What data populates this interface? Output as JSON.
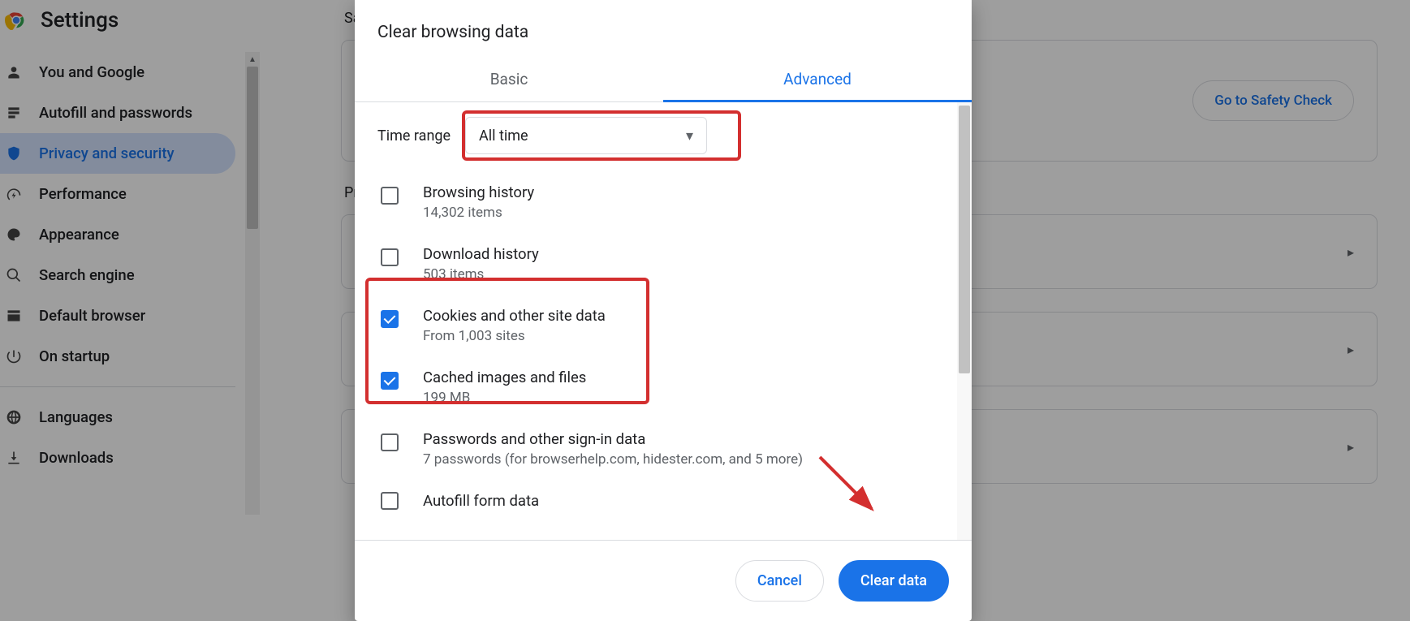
{
  "app": {
    "title": "Settings"
  },
  "sidebar": {
    "items": [
      {
        "label": "You and Google"
      },
      {
        "label": "Autofill and passwords"
      },
      {
        "label": "Privacy and security"
      },
      {
        "label": "Performance"
      },
      {
        "label": "Appearance"
      },
      {
        "label": "Search engine"
      },
      {
        "label": "Default browser"
      },
      {
        "label": "On startup"
      },
      {
        "label": "Languages"
      },
      {
        "label": "Downloads"
      }
    ]
  },
  "main": {
    "section_safety_prefix": "Sa",
    "safety_button": "Go to Safety Check",
    "section_privacy_prefix": "Pr"
  },
  "dialog": {
    "title": "Clear browsing data",
    "tabs": {
      "basic": "Basic",
      "advanced": "Advanced"
    },
    "time_label": "Time range",
    "time_value": "All time",
    "options": [
      {
        "title": "Browsing history",
        "sub": "14,302 items",
        "checked": false
      },
      {
        "title": "Download history",
        "sub": "503 items",
        "checked": false
      },
      {
        "title": "Cookies and other site data",
        "sub": "From 1,003 sites",
        "checked": true
      },
      {
        "title": "Cached images and files",
        "sub": "199 MB",
        "checked": true
      },
      {
        "title": "Passwords and other sign-in data",
        "sub": "7 passwords (for browserhelp.com, hidester.com, and 5 more)",
        "checked": false
      },
      {
        "title": "Autofill form data",
        "sub": "",
        "checked": false
      }
    ],
    "cancel": "Cancel",
    "clear": "Clear data"
  }
}
